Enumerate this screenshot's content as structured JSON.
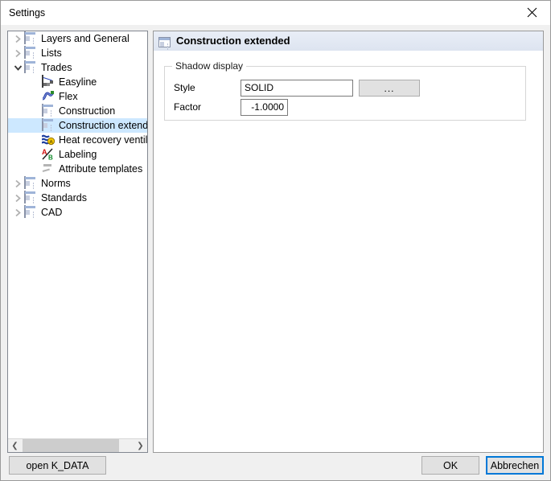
{
  "window": {
    "title": "Settings",
    "close_icon": "close-icon"
  },
  "tree": {
    "items": [
      {
        "label": "Layers and General",
        "icon": "page-icon",
        "indent": 0,
        "arrow": "collapsed",
        "selected": false
      },
      {
        "label": "Lists",
        "icon": "page-icon",
        "indent": 0,
        "arrow": "collapsed",
        "selected": false
      },
      {
        "label": "Trades",
        "icon": "page-icon",
        "indent": 0,
        "arrow": "expanded",
        "selected": false
      },
      {
        "label": "Easyline",
        "icon": "easyline-icon",
        "indent": 1,
        "arrow": "none",
        "selected": false
      },
      {
        "label": "Flex",
        "icon": "flex-icon",
        "indent": 1,
        "arrow": "none",
        "selected": false
      },
      {
        "label": "Construction",
        "icon": "page-icon",
        "indent": 1,
        "arrow": "none",
        "selected": false
      },
      {
        "label": "Construction extended",
        "icon": "page-icon",
        "indent": 1,
        "arrow": "none",
        "selected": true
      },
      {
        "label": "Heat recovery ventilation",
        "icon": "heat-recovery-icon",
        "indent": 1,
        "arrow": "none",
        "selected": false
      },
      {
        "label": "Labeling",
        "icon": "labeling-icon",
        "indent": 1,
        "arrow": "none",
        "selected": false
      },
      {
        "label": "Attribute templates",
        "icon": "attribute-icon",
        "indent": 1,
        "arrow": "none",
        "selected": false
      },
      {
        "label": "Norms",
        "icon": "page-icon",
        "indent": 0,
        "arrow": "collapsed",
        "selected": false
      },
      {
        "label": "Standards",
        "icon": "page-icon",
        "indent": 0,
        "arrow": "collapsed",
        "selected": false
      },
      {
        "label": "CAD",
        "icon": "page-icon",
        "indent": 0,
        "arrow": "collapsed",
        "selected": false
      }
    ],
    "hscroll": {
      "left_arrow": "❮",
      "right_arrow": "❯"
    }
  },
  "content": {
    "header_title": "Construction extended",
    "header_icon": "page-icon",
    "groupbox": {
      "legend": "Shadow display",
      "fields": {
        "style_label": "Style",
        "style_value": "SOLID",
        "style_placeholder": "",
        "browse_label": "...",
        "factor_label": "Factor",
        "factor_value": "-1.0000",
        "factor_placeholder": ""
      }
    }
  },
  "buttons": {
    "open_kdata": "open K_DATA",
    "ok": "OK",
    "cancel": "Abbrechen"
  },
  "colors": {
    "selection": "#cde8ff",
    "focus_border": "#0078d7",
    "header_gradient_top": "#e9eef7",
    "header_gradient_bottom": "#dde4f0",
    "dialog_background": "#f0f0f0",
    "button_face": "#e1e1e1"
  }
}
